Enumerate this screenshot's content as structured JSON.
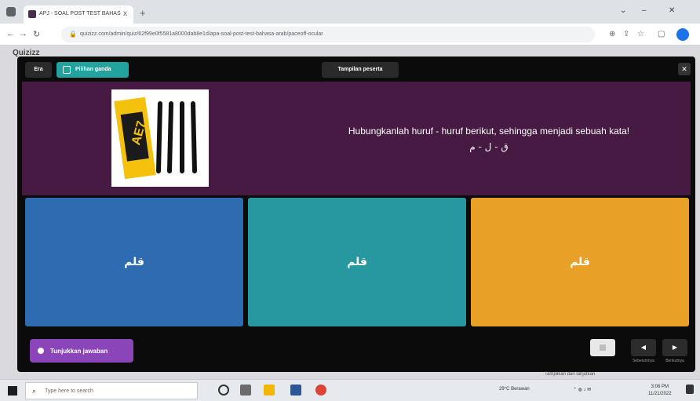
{
  "browser": {
    "tab_title": "APJ - SOAL POST TEST BAHAS",
    "tab_close": "x",
    "new_tab": "+",
    "url": "quizizz.com/admin/quiz/62f99e0f5581a8000dab8e1d/apa-soal-post-test-bahasa-arab/paceoff-ocular",
    "window_minimize": "⌄",
    "window_restore": "–",
    "window_close": "✕"
  },
  "page": {
    "logo": "Quizizz"
  },
  "modal": {
    "era_label": "Era",
    "pilihan_ganda_label": "Pilihan ganda",
    "tampilan_peserta_label": "Tampilan peserta",
    "close_label": "✕",
    "question_text": "Hubungkanlah huruf - huruf berikut, sehingga menjadi sebuah kata!",
    "question_arabic": "ق - ل - م",
    "options": [
      {
        "text": "قلم",
        "color": "#2e6bb0"
      },
      {
        "text": "قلم",
        "color": "#2797a0"
      },
      {
        "text": "قلم",
        "color": "#e9a026"
      }
    ],
    "show_answer_label": "Tunjukkan jawaban",
    "prev_label": "Sebelumnya",
    "next_label": "Berikutnya"
  },
  "popup": {
    "text": "Tampilkan dan lanjutkan"
  },
  "taskbar": {
    "search_placeholder": "Type here to search",
    "weather": "29°C Berawan",
    "time": "3:06 PM",
    "date": "11/21/2022"
  },
  "colors": {
    "modal_bg": "#0c0b0c",
    "question_bg": "#461a42",
    "pilihan_ganda": "#23a39d",
    "show_answer": "#8a45b8"
  }
}
